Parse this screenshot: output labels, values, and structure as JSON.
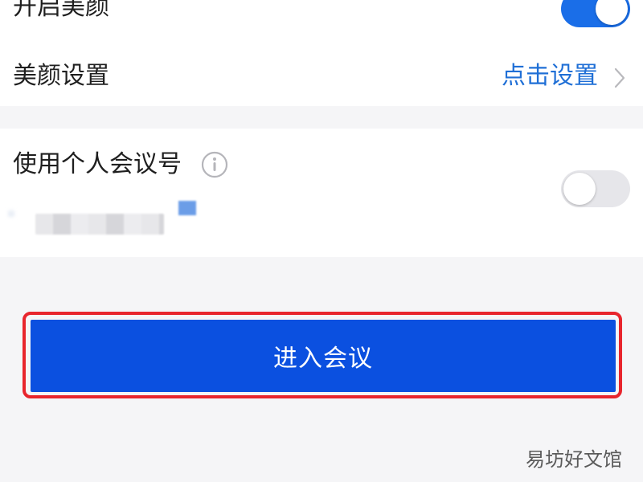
{
  "settings": {
    "beauty_toggle": {
      "label": "开启美颜",
      "state": "on"
    },
    "beauty_settings": {
      "label": "美颜设置",
      "action_label": "点击设置",
      "action_icon": "chevron-right-icon"
    },
    "personal_meeting_id": {
      "label": "使用个人会议号",
      "info_icon": "info-icon",
      "state": "off"
    }
  },
  "primary_action": {
    "label": "进入会议"
  },
  "watermark": {
    "text": "易坊好文馆"
  },
  "colors": {
    "accent": "#1a6ee8",
    "button": "#0b50e0",
    "link": "#1f6fd6",
    "highlight": "#e8252d"
  }
}
